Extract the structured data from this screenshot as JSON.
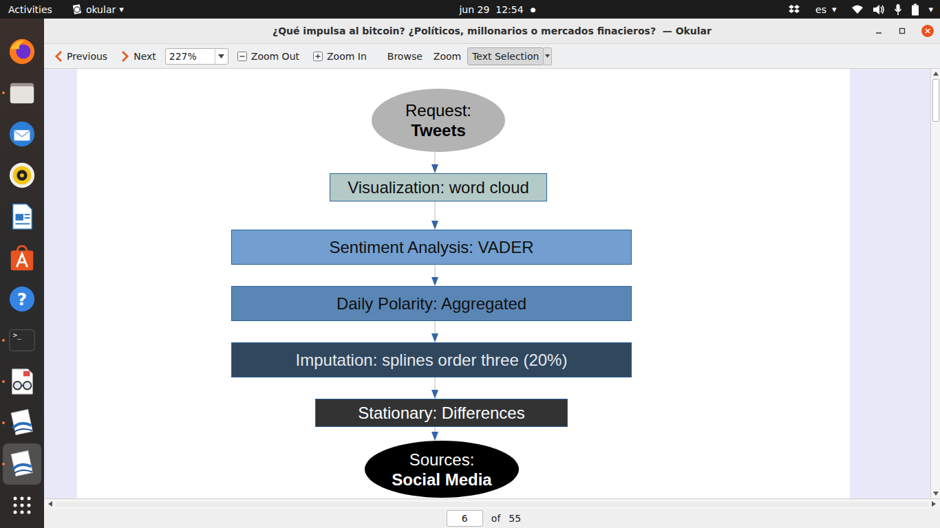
{
  "topbar": {
    "activities": "Activities",
    "app_menu": {
      "label": "okular",
      "arrow": "▾"
    },
    "clock": "jun 29  12:54",
    "indicator": "●",
    "language": {
      "label": "es",
      "arrow": "▾"
    },
    "system_arrow": "▾"
  },
  "dock": [
    {
      "kind": "firefox",
      "running": false,
      "active": false
    },
    {
      "kind": "files",
      "running": true,
      "active": false
    },
    {
      "kind": "thunderbird",
      "running": false,
      "active": false
    },
    {
      "kind": "rhythmbox",
      "running": false,
      "active": false
    },
    {
      "kind": "writer",
      "running": false,
      "active": false
    },
    {
      "kind": "appcenter",
      "running": false,
      "active": false
    },
    {
      "kind": "help",
      "running": false,
      "active": false,
      "glyph": "?"
    },
    {
      "kind": "terminal",
      "running": true,
      "active": false,
      "glyph": ">_"
    },
    {
      "kind": "reader",
      "running": true,
      "active": false
    },
    {
      "kind": "okular",
      "running": true,
      "active": false
    },
    {
      "kind": "okular",
      "running": true,
      "active": true
    }
  ],
  "window": {
    "title": "¿Qué impulsa al bitcoin? ¿Políticos, millonarios o mercados finacieros?  — Okular"
  },
  "toolbar": {
    "previous": "Previous",
    "next": "Next",
    "zoom": "227%",
    "zoom_out": "Zoom Out",
    "zoom_in": "Zoom In",
    "modes": [
      {
        "label": "Browse",
        "selected": false
      },
      {
        "label": "Zoom",
        "selected": false
      },
      {
        "label": "Text Selection",
        "selected": true
      }
    ]
  },
  "diagram": {
    "nodes": [
      {
        "kind": "ellipse",
        "lines": [
          {
            "text": "Request:",
            "bold": false
          },
          {
            "text": "Tweets",
            "bold": true
          }
        ],
        "color": "#b3b3b3",
        "text_color": "#000000"
      },
      {
        "kind": "box",
        "lines": [
          {
            "text": "Visualization: word cloud",
            "bold": false
          }
        ],
        "color": "#b4cac6",
        "text_color": "#111111"
      },
      {
        "kind": "box",
        "lines": [
          {
            "text": "Sentiment Analysis: VADER",
            "bold": false
          }
        ],
        "color": "#729fcf",
        "text_color": "#111111"
      },
      {
        "kind": "box",
        "lines": [
          {
            "text": "Daily Polarity: Aggregated",
            "bold": false
          }
        ],
        "color": "#5a86b5",
        "text_color": "#111111"
      },
      {
        "kind": "box",
        "lines": [
          {
            "text": "Imputation: splines order three (20%)",
            "bold": false
          }
        ],
        "color": "#30475e",
        "text_color": "#e4e9ee"
      },
      {
        "kind": "box",
        "lines": [
          {
            "text": "Stationary: Differences",
            "bold": false
          }
        ],
        "color": "#333333",
        "text_color": "#ffffff"
      },
      {
        "kind": "ellipse",
        "lines": [
          {
            "text": "Sources:",
            "bold": false
          },
          {
            "text": "Social Media",
            "bold": true
          }
        ],
        "color": "#000000",
        "text_color": "#ffffff"
      }
    ]
  },
  "pager": {
    "page": "6",
    "of": "of",
    "total": "55"
  }
}
